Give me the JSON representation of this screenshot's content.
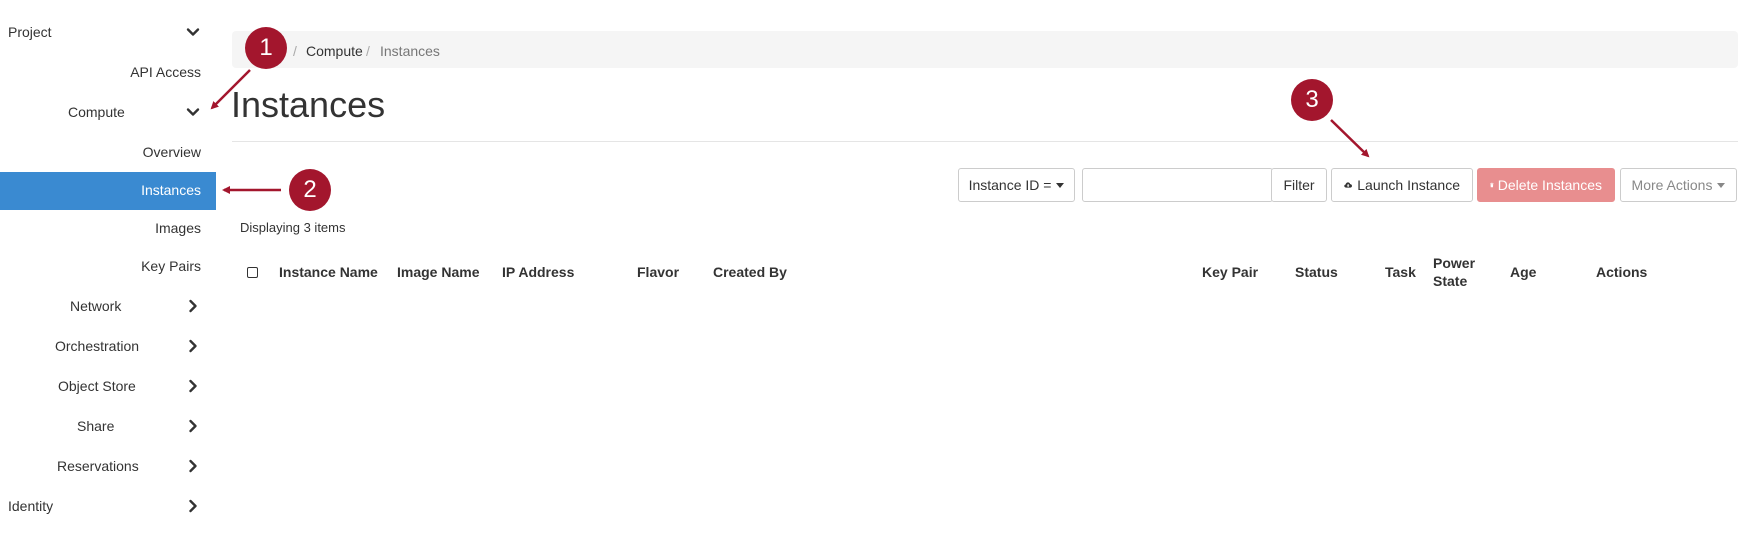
{
  "sidebar": {
    "items": [
      {
        "label": "Project",
        "icon": "chevron-down-icon"
      },
      {
        "label": "API Access"
      },
      {
        "label": "Compute",
        "icon": "chevron-down-icon"
      },
      {
        "label": "Overview"
      },
      {
        "label": "Instances",
        "active": true
      },
      {
        "label": "Images"
      },
      {
        "label": "Key Pairs"
      },
      {
        "label": "Network",
        "icon": "chevron-right-icon"
      },
      {
        "label": "Orchestration",
        "icon": "chevron-right-icon"
      },
      {
        "label": "Object Store",
        "icon": "chevron-right-icon"
      },
      {
        "label": "Share",
        "icon": "chevron-right-icon"
      },
      {
        "label": "Reservations",
        "icon": "chevron-right-icon"
      },
      {
        "label": "Identity",
        "icon": "chevron-right-icon"
      }
    ]
  },
  "breadcrumb": {
    "items": [
      "Compute",
      "Instances"
    ],
    "separator": "/"
  },
  "page": {
    "title": "Instances"
  },
  "toolbar": {
    "filter_field": "Instance ID =",
    "filter_value": "",
    "filter_button": "Filter",
    "launch_button": "Launch Instance",
    "launch_icon": "cloud-upload-icon",
    "delete_button": "Delete Instances",
    "delete_icon": "trash-icon",
    "more_button": "More Actions"
  },
  "table": {
    "count_text": "Displaying 3 items",
    "columns": [
      "Instance Name",
      "Image Name",
      "IP Address",
      "Flavor",
      "Created By",
      "Key Pair",
      "Status",
      "Task",
      "Power State",
      "Age",
      "Actions"
    ],
    "rows": []
  },
  "annotations": {
    "badges": [
      "1",
      "2",
      "3"
    ]
  },
  "colors": {
    "active": "#3a8ad1",
    "badge": "#a3162d",
    "danger": "#e88e8f",
    "breadcrumb_bg": "#f5f5f5"
  }
}
